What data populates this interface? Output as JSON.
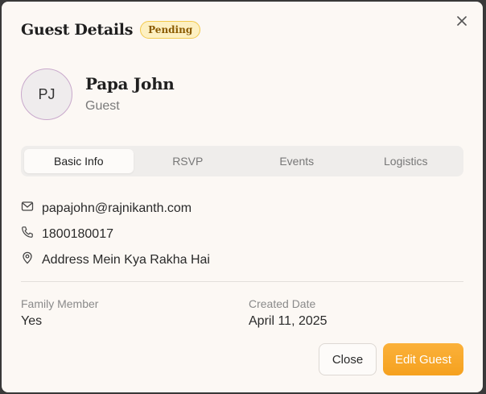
{
  "dialog": {
    "title": "Guest Details",
    "status_badge": "Pending",
    "colors": {
      "accent": "#f5a623",
      "badge_bg": "#fdf0c2",
      "badge_text": "#8a5a00"
    }
  },
  "guest": {
    "initials": "PJ",
    "name": "Papa John",
    "role": "Guest"
  },
  "tabs": [
    {
      "label": "Basic Info",
      "active": true
    },
    {
      "label": "RSVP",
      "active": false
    },
    {
      "label": "Events",
      "active": false
    },
    {
      "label": "Logistics",
      "active": false
    }
  ],
  "contact": {
    "email": "papajohn@rajnikanth.com",
    "phone": "1800180017",
    "address": "Address Mein Kya Rakha Hai"
  },
  "fields": {
    "family_member": {
      "label": "Family Member",
      "value": "Yes"
    },
    "created_date": {
      "label": "Created Date",
      "value": "April 11, 2025"
    }
  },
  "buttons": {
    "close": "Close",
    "edit": "Edit Guest"
  },
  "icons": [
    "close-icon",
    "mail-icon",
    "phone-icon",
    "map-pin-icon"
  ]
}
